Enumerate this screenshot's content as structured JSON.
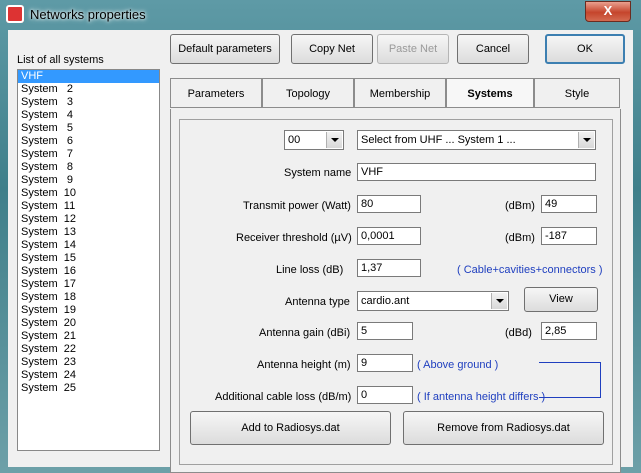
{
  "window": {
    "title": "Networks properties",
    "close_glyph": "X"
  },
  "list": {
    "label": "List of all systems",
    "items": [
      "VHF",
      "System   2",
      "System   3",
      "System   4",
      "System   5",
      "System   6",
      "System   7",
      "System   8",
      "System   9",
      "System  10",
      "System  11",
      "System  12",
      "System  13",
      "System  14",
      "System  15",
      "System  16",
      "System  17",
      "System  18",
      "System  19",
      "System  20",
      "System  21",
      "System  22",
      "System  23",
      "System  24",
      "System  25"
    ],
    "selected": "VHF"
  },
  "toolbar": {
    "default_params": "Default parameters",
    "copy_net": "Copy Net",
    "paste_net": "Paste Net",
    "cancel": "Cancel",
    "ok": "OK"
  },
  "tabs": [
    "Parameters",
    "Topology",
    "Membership",
    "Systems",
    "Style"
  ],
  "active_tab": "Systems",
  "form": {
    "system_index": "00",
    "system_select": "Select from UHF ... System   1 ...",
    "system_name_label": "System name",
    "system_name": "VHF",
    "tx_power_label": "Transmit power (Watt)",
    "tx_power": "80",
    "dbm_label": "(dBm)",
    "tx_power_dbm": "49",
    "rx_threshold_label": "Receiver threshold (µV)",
    "rx_threshold": "0,0001",
    "rx_threshold_dbm": "-187",
    "line_loss_label": "Line loss (dB)",
    "line_loss": "1,37",
    "line_loss_note": "( Cable+cavities+connectors )",
    "antenna_type_label": "Antenna type",
    "antenna_type": "cardio.ant",
    "view_button": "View",
    "antenna_gain_label": "Antenna gain (dBi)",
    "antenna_gain": "5",
    "dbd_label": "(dBd)",
    "antenna_gain_dbd": "2,85",
    "antenna_height_label": "Antenna height (m)",
    "antenna_height": "9",
    "antenna_height_note": "( Above ground )",
    "cable_loss_label": "Additional cable loss (dB/m)",
    "cable_loss": "0",
    "cable_loss_note": "( If antenna height differs )",
    "add_button": "Add to Radiosys.dat",
    "remove_button": "Remove from Radiosys.dat"
  },
  "colors": {
    "note_blue": "#1f3fbf",
    "selection": "#3399ff"
  }
}
